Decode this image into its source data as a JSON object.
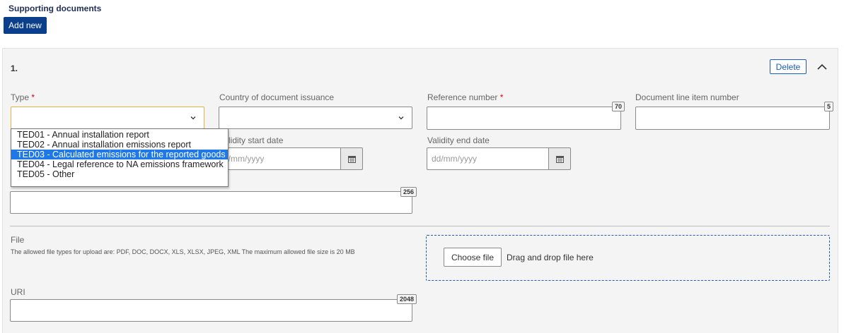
{
  "section": {
    "title": "Supporting documents",
    "add_label": "Add new"
  },
  "item": {
    "number": "1.",
    "delete_label": "Delete"
  },
  "fields": {
    "type": {
      "label": "Type",
      "required_mark": "*",
      "value": ""
    },
    "country": {
      "label": "Country of document issuance",
      "value": ""
    },
    "reference": {
      "label": "Reference number",
      "required_mark": "*",
      "counter": "70"
    },
    "line_item": {
      "label": "Document line item number",
      "counter": "5"
    },
    "validity_start": {
      "label": "Validity start date",
      "label_visible": "lidity start date",
      "placeholder": "dd/mm/yyyy",
      "placeholder_visible": "d/mm/yyyy"
    },
    "validity_end": {
      "label": "Validity end date",
      "placeholder": "dd/mm/yyyy"
    },
    "description": {
      "counter": "256"
    },
    "file": {
      "label": "File",
      "hint": "The allowed file types for upload are: PDF, DOC, DOCX, XLS, XLSX, JPEG, XML The maximum allowed file size is 20 MB",
      "choose_label": "Choose file",
      "drop_label": "Drag and drop file here"
    },
    "uri": {
      "label": "URI",
      "counter": "2048"
    }
  },
  "type_dropdown": {
    "options": [
      "TED01 - Annual installation report",
      "TED02 - Annual installation emissions report",
      "TED03 - Calculated emissions for the reported goods",
      "TED04 - Legal reference to NA emissions framework",
      "TED05 - Other"
    ],
    "highlighted_index": 2
  },
  "icons": {
    "chevron_down": "chevron-down-icon",
    "chevron_up": "chevron-up-icon",
    "calendar": "calendar-icon"
  },
  "colors": {
    "primary": "#0b3f8c",
    "link_blue": "#1c5bb8",
    "required": "#d0021b",
    "focus": "#e0b43a",
    "highlight": "#1e78e6"
  }
}
